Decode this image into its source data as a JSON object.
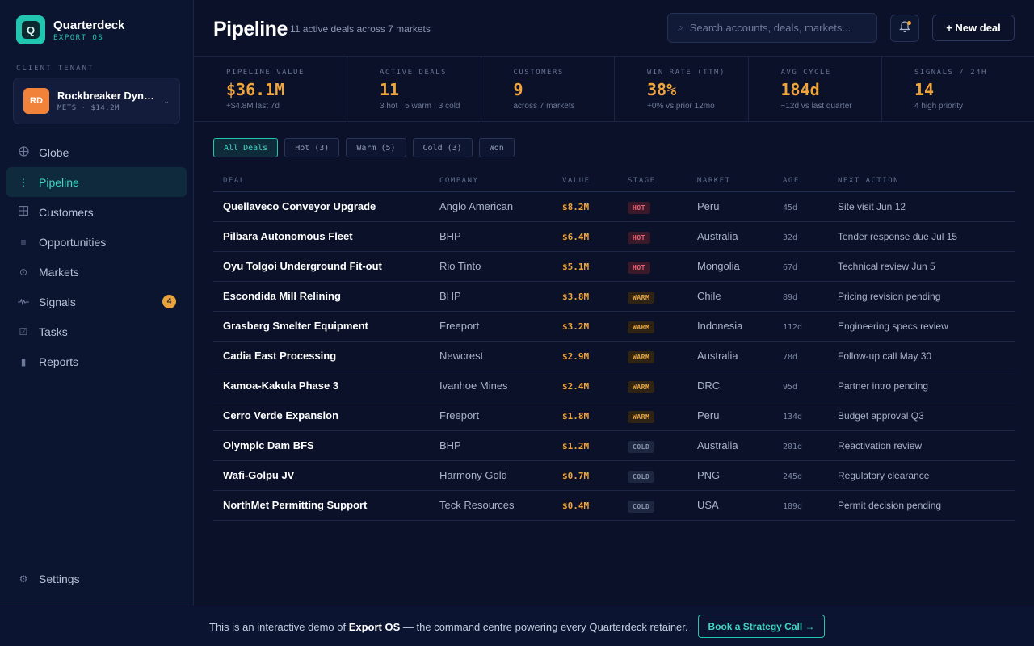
{
  "brand": {
    "name": "Quarterdeck",
    "sub": "EXPORT OS",
    "logo_letter": "Q"
  },
  "tenant": {
    "label": "CLIENT TENANT",
    "initials": "RD",
    "name": "Rockbreaker Dynamics",
    "meta": "METS · $14.2M"
  },
  "nav": {
    "items": [
      {
        "label": "Globe",
        "icon": "globe-icon"
      },
      {
        "label": "Pipeline",
        "icon": "pipeline-icon",
        "active": true
      },
      {
        "label": "Customers",
        "icon": "grid-icon"
      },
      {
        "label": "Opportunities",
        "icon": "list-icon"
      },
      {
        "label": "Markets",
        "icon": "target-icon"
      },
      {
        "label": "Signals",
        "icon": "signal-icon",
        "badge": "4"
      },
      {
        "label": "Tasks",
        "icon": "checkbox-icon"
      },
      {
        "label": "Reports",
        "icon": "bar-icon"
      }
    ],
    "settings": "Settings"
  },
  "header": {
    "title": "Pipeline",
    "subtitle": "11 active deals across 7 markets",
    "search_placeholder": "Search accounts, deals, markets...",
    "new_deal": "+ New deal"
  },
  "stats": [
    {
      "label": "PIPELINE VALUE",
      "value": "$36.1M",
      "sub": "+$4.8M last 7d"
    },
    {
      "label": "ACTIVE DEALS",
      "value": "11",
      "sub": "3 hot · 5 warm · 3 cold"
    },
    {
      "label": "CUSTOMERS",
      "value": "9",
      "sub": "across 7 markets"
    },
    {
      "label": "WIN RATE (TTM)",
      "value": "38%",
      "sub": "+0% vs prior 12mo"
    },
    {
      "label": "AVG CYCLE",
      "value": "184d",
      "sub": "−12d vs last quarter"
    },
    {
      "label": "SIGNALS / 24H",
      "value": "14",
      "sub": "4 high priority"
    }
  ],
  "filters": [
    "All Deals",
    "Hot (3)",
    "Warm (5)",
    "Cold (3)",
    "Won"
  ],
  "table": {
    "headers": [
      "DEAL",
      "COMPANY",
      "VALUE",
      "STAGE",
      "MARKET",
      "AGE",
      "NEXT ACTION"
    ],
    "rows": [
      {
        "deal": "Quellaveco Conveyor Upgrade",
        "company": "Anglo American",
        "value": "$8.2M",
        "stage": "HOT",
        "market": "Peru",
        "age": "45d",
        "next": "Site visit Jun 12"
      },
      {
        "deal": "Pilbara Autonomous Fleet",
        "company": "BHP",
        "value": "$6.4M",
        "stage": "HOT",
        "market": "Australia",
        "age": "32d",
        "next": "Tender response due Jul 15"
      },
      {
        "deal": "Oyu Tolgoi Underground Fit-out",
        "company": "Rio Tinto",
        "value": "$5.1M",
        "stage": "HOT",
        "market": "Mongolia",
        "age": "67d",
        "next": "Technical review Jun 5"
      },
      {
        "deal": "Escondida Mill Relining",
        "company": "BHP",
        "value": "$3.8M",
        "stage": "WARM",
        "market": "Chile",
        "age": "89d",
        "next": "Pricing revision pending"
      },
      {
        "deal": "Grasberg Smelter Equipment",
        "company": "Freeport",
        "value": "$3.2M",
        "stage": "WARM",
        "market": "Indonesia",
        "age": "112d",
        "next": "Engineering specs review"
      },
      {
        "deal": "Cadia East Processing",
        "company": "Newcrest",
        "value": "$2.9M",
        "stage": "WARM",
        "market": "Australia",
        "age": "78d",
        "next": "Follow-up call May 30"
      },
      {
        "deal": "Kamoa-Kakula Phase 3",
        "company": "Ivanhoe Mines",
        "value": "$2.4M",
        "stage": "WARM",
        "market": "DRC",
        "age": "95d",
        "next": "Partner intro pending"
      },
      {
        "deal": "Cerro Verde Expansion",
        "company": "Freeport",
        "value": "$1.8M",
        "stage": "WARM",
        "market": "Peru",
        "age": "134d",
        "next": "Budget approval Q3"
      },
      {
        "deal": "Olympic Dam BFS",
        "company": "BHP",
        "value": "$1.2M",
        "stage": "COLD",
        "market": "Australia",
        "age": "201d",
        "next": "Reactivation review"
      },
      {
        "deal": "Wafi-Golpu JV",
        "company": "Harmony Gold",
        "value": "$0.7M",
        "stage": "COLD",
        "market": "PNG",
        "age": "245d",
        "next": "Regulatory clearance"
      },
      {
        "deal": "NorthMet Permitting Support",
        "company": "Teck Resources",
        "value": "$0.4M",
        "stage": "COLD",
        "market": "USA",
        "age": "189d",
        "next": "Permit decision pending"
      }
    ]
  },
  "footer": {
    "text_before": "This is an interactive demo of ",
    "text_bold": "Export OS",
    "text_after": " — the command centre powering every Quarterdeck retainer.",
    "cta": "Book a Strategy Call →"
  },
  "colors": {
    "accent": "#22c5b0",
    "value": "#f0a43c",
    "hot": "#f25d6e",
    "warm": "#e8a33c",
    "cold": "#8a95ad"
  }
}
